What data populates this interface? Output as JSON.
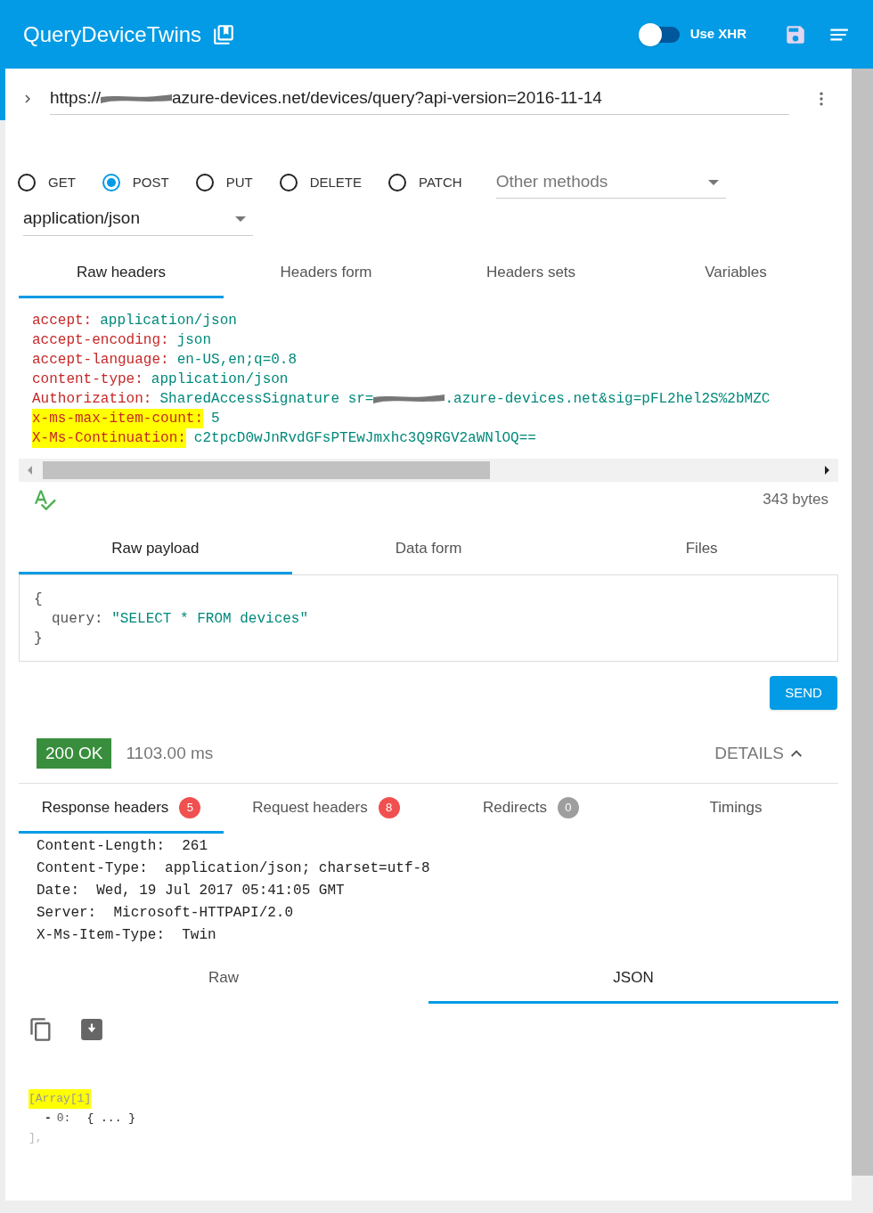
{
  "app_bar": {
    "title": "QueryDeviceTwins",
    "xhr_toggle": {
      "label": "Use XHR",
      "on": false
    }
  },
  "url": {
    "before_redaction": "https://",
    "after_redaction": "azure-devices.net/devices/query?api-version=2016-11-14"
  },
  "methods": [
    {
      "label": "GET",
      "selected": false
    },
    {
      "label": "POST",
      "selected": true
    },
    {
      "label": "PUT",
      "selected": false
    },
    {
      "label": "DELETE",
      "selected": false
    },
    {
      "label": "PATCH",
      "selected": false
    }
  ],
  "other_methods": {
    "placeholder": "Other methods"
  },
  "content_type": {
    "value": "application/json"
  },
  "header_tabs": [
    {
      "label": "Raw headers",
      "selected": true
    },
    {
      "label": "Headers form",
      "selected": false
    },
    {
      "label": "Headers sets",
      "selected": false
    },
    {
      "label": "Variables",
      "selected": false
    }
  ],
  "raw_headers": [
    {
      "name": "accept:",
      "value": "application/json",
      "highlighted": false
    },
    {
      "name": "accept-encoding:",
      "value": "json",
      "highlighted": false
    },
    {
      "name": "accept-language:",
      "value": "en-US,en;q=0.8",
      "highlighted": false
    },
    {
      "name": "content-type:",
      "value": "application/json",
      "highlighted": false
    },
    {
      "name": "Authorization:",
      "value": "SharedAccessSignature sr=",
      "value_after_redaction": ".azure-devices.net&sig=pFL2hel2S%2bMZC",
      "highlighted": false
    },
    {
      "name": "x-ms-max-item-count:",
      "value": "5",
      "highlighted": true
    },
    {
      "name": "X-Ms-Continuation:",
      "value": "c2tpcD0wJnRvdGFsPTEwJmxhc3Q9RGV2aWNlOQ==",
      "highlighted": true
    }
  ],
  "headers_size": "343 bytes",
  "payload_tabs": [
    {
      "label": "Raw payload",
      "selected": true
    },
    {
      "label": "Data form",
      "selected": false
    },
    {
      "label": "Files",
      "selected": false
    }
  ],
  "payload": {
    "open_brace": "{",
    "key": "query:",
    "value": "\"SELECT * FROM devices\"",
    "close_brace": "}"
  },
  "send_button": "SEND",
  "response": {
    "status": "200 OK",
    "time": "1103.00 ms",
    "details": "DETAILS"
  },
  "response_tabs": [
    {
      "label": "Response headers",
      "count": "5",
      "color": "#f0504f",
      "selected": true
    },
    {
      "label": "Request headers",
      "count": "8",
      "color": "#f0504f",
      "selected": false
    },
    {
      "label": "Redirects",
      "count": "0",
      "color": "#9e9e9e",
      "selected": false
    },
    {
      "label": "Timings",
      "selected": false
    }
  ],
  "response_headers": [
    {
      "name": "Content-Length:",
      "value": "261"
    },
    {
      "name": "Content-Type:",
      "value": "application/json; charset=utf-8"
    },
    {
      "name": "Date:",
      "value": "Wed, 19 Jul 2017 05:41:05 GMT"
    },
    {
      "name": "Server:",
      "value": "Microsoft-HTTPAPI/2.0"
    },
    {
      "name": "X-Ms-Item-Type:",
      "value": "Twin"
    }
  ],
  "body_tabs": [
    {
      "label": "Raw",
      "selected": false
    },
    {
      "label": "JSON",
      "selected": true
    }
  ],
  "json_view": {
    "array_label": "[Array[1]",
    "item_toggle": "-",
    "item_key": "0:",
    "item_value": "{ ... }",
    "close": "],"
  }
}
